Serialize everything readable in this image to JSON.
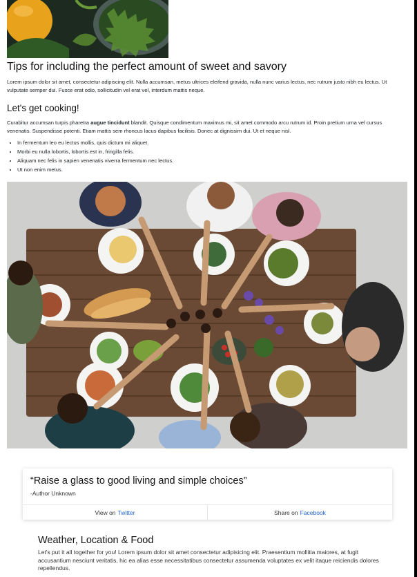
{
  "header_image": {
    "icon": "food-photo",
    "description_colors": [
      "#1f2a22",
      "#f0a020",
      "#3c6b2c"
    ]
  },
  "section1": {
    "title": "Tips for including the perfect amount of sweet and savory",
    "body": "Lorem ipsum dolor sit amet, consectetur adipiscing elit. Nulla accumsan, metus ultrices eleifend gravida, nulla nunc varius lectus, nec rutrum justo nibh eu lectus. Ut vulputate semper dui. Fusce erat odio, sollicitudin vel erat vel, interdum mattis neque."
  },
  "section2": {
    "title": "Let's get cooking!",
    "body_before": "Curabitur accumsan turpis pharetra ",
    "body_bold": "augue tincidunt",
    "body_after": " blandit. Quisque condimentum maximus mi, sit amet commodo arcu rutrum id. Proin pretium urna vel cursus venenatis. Suspendisse potenti. Etiam mattis sem rhoncus lacus dapibus facilisis. Donec at dignissim dui. Ut et neque nisl.",
    "bullets": [
      "In fermentum leo eu lectus mollis, quis dictum mi aliquet.",
      "Morbi eu nulla lobortis, lobortis est in, fringilla felis.",
      "Aliquam nec felis in sapien venenatis viverra fermentum nec lectus.",
      "Ut non enim metus."
    ]
  },
  "photo": {
    "icon": "dinner-table-photo"
  },
  "quote": {
    "text": "“Raise a glass to good living and simple choices”",
    "author": "-Author Unknown",
    "view_prefix": "View on",
    "view_link": "Twitter",
    "share_prefix": "Share on",
    "share_link": "Facebook",
    "link_color": "#1a5fd0"
  },
  "section3": {
    "title": "Weather, Location & Food",
    "body": "Let's put it all together for you! Lorem ipsum dolor sit amet consectetur adipisicing elit. Praesentium mollitia maiores, at fugit accusantium nesciunt veritatis, hic ea alias esse necessitatibus consectetur assumenda voluptates ex velit itaque reiciendis dolores repellendus."
  }
}
